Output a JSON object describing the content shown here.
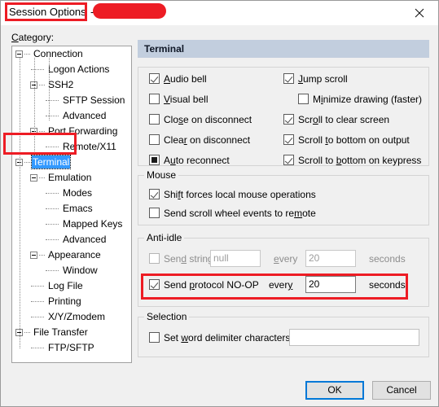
{
  "window": {
    "title": "Session Options",
    "title_separator": "-",
    "redacted_label": "",
    "close_icon": "close-icon"
  },
  "category": {
    "label": "Category:",
    "label_mnemonic": "C",
    "items": [
      {
        "text": "Connection",
        "depth": 0,
        "expander": true,
        "selected": false
      },
      {
        "text": "Logon Actions",
        "depth": 1,
        "expander": false,
        "selected": false
      },
      {
        "text": "SSH2",
        "depth": 1,
        "expander": true,
        "selected": false
      },
      {
        "text": "SFTP Session",
        "depth": 2,
        "expander": false,
        "selected": false
      },
      {
        "text": "Advanced",
        "depth": 2,
        "expander": false,
        "selected": false
      },
      {
        "text": "Port Forwarding",
        "depth": 1,
        "expander": true,
        "selected": false
      },
      {
        "text": "Remote/X11",
        "depth": 2,
        "expander": false,
        "selected": false
      },
      {
        "text": "Terminal",
        "depth": 0,
        "expander": true,
        "selected": true
      },
      {
        "text": "Emulation",
        "depth": 1,
        "expander": true,
        "selected": false
      },
      {
        "text": "Modes",
        "depth": 2,
        "expander": false,
        "selected": false
      },
      {
        "text": "Emacs",
        "depth": 2,
        "expander": false,
        "selected": false
      },
      {
        "text": "Mapped Keys",
        "depth": 2,
        "expander": false,
        "selected": false
      },
      {
        "text": "Advanced",
        "depth": 2,
        "expander": false,
        "selected": false
      },
      {
        "text": "Appearance",
        "depth": 1,
        "expander": true,
        "selected": false
      },
      {
        "text": "Window",
        "depth": 2,
        "expander": false,
        "selected": false
      },
      {
        "text": "Log File",
        "depth": 1,
        "expander": false,
        "selected": false
      },
      {
        "text": "Printing",
        "depth": 1,
        "expander": false,
        "selected": false
      },
      {
        "text": "X/Y/Zmodem",
        "depth": 1,
        "expander": false,
        "selected": false
      },
      {
        "text": "File Transfer",
        "depth": 0,
        "expander": true,
        "selected": false
      },
      {
        "text": "FTP/SFTP",
        "depth": 1,
        "expander": false,
        "selected": false
      }
    ]
  },
  "pane": {
    "header": "Terminal",
    "terminal_options": {
      "left_column": [
        {
          "label": "Audio bell",
          "state": "checked",
          "disabled": false
        },
        {
          "label": "Visual bell",
          "state": "unchecked",
          "disabled": false
        },
        {
          "label": "Close on disconnect",
          "state": "unchecked",
          "disabled": false
        },
        {
          "label": "Clear on disconnect",
          "state": "unchecked",
          "disabled": false
        },
        {
          "label": "Auto reconnect",
          "state": "filled",
          "disabled": false
        }
      ],
      "right_column": [
        {
          "label": "Jump scroll",
          "state": "checked",
          "disabled": false,
          "indent": 0
        },
        {
          "label": "Minimize drawing (faster)",
          "state": "unchecked",
          "disabled": false,
          "indent": 1
        },
        {
          "label": "Scroll to clear screen",
          "state": "checked",
          "disabled": false,
          "indent": 0
        },
        {
          "label": "Scroll to bottom on output",
          "state": "checked",
          "disabled": false,
          "indent": 0
        },
        {
          "label": "Scroll to bottom on keypress",
          "state": "checked",
          "disabled": false,
          "indent": 0
        }
      ]
    },
    "mouse": {
      "legend": "Mouse",
      "options": [
        {
          "label": "Shift forces local mouse operations",
          "state": "checked",
          "disabled": false
        },
        {
          "label": "Send scroll wheel events to remote",
          "state": "unchecked",
          "disabled": false
        }
      ]
    },
    "anti_idle": {
      "legend": "Anti-idle",
      "send_string": {
        "label": "Send string:",
        "state": "unchecked",
        "disabled": true,
        "value": "null",
        "every_label": "every",
        "interval": "20",
        "seconds_label": "seconds"
      },
      "send_noop": {
        "label": "Send protocol NO-OP",
        "state": "checked",
        "disabled": false,
        "every_label": "every",
        "interval": "20",
        "seconds_label": "seconds",
        "highlighted": true
      }
    },
    "selection": {
      "legend": "Selection",
      "option": {
        "label": "Set word delimiter characters:",
        "state": "unchecked",
        "disabled": false,
        "value": ""
      }
    }
  },
  "footer": {
    "ok_label": "OK",
    "cancel_label": "Cancel"
  },
  "colors": {
    "annotation_red": "#ed1c24",
    "selection_blue": "#3399ff",
    "header_blue": "#c2cede",
    "focus_blue": "#0078d7",
    "dialog_bg": "#f0f0f0"
  }
}
